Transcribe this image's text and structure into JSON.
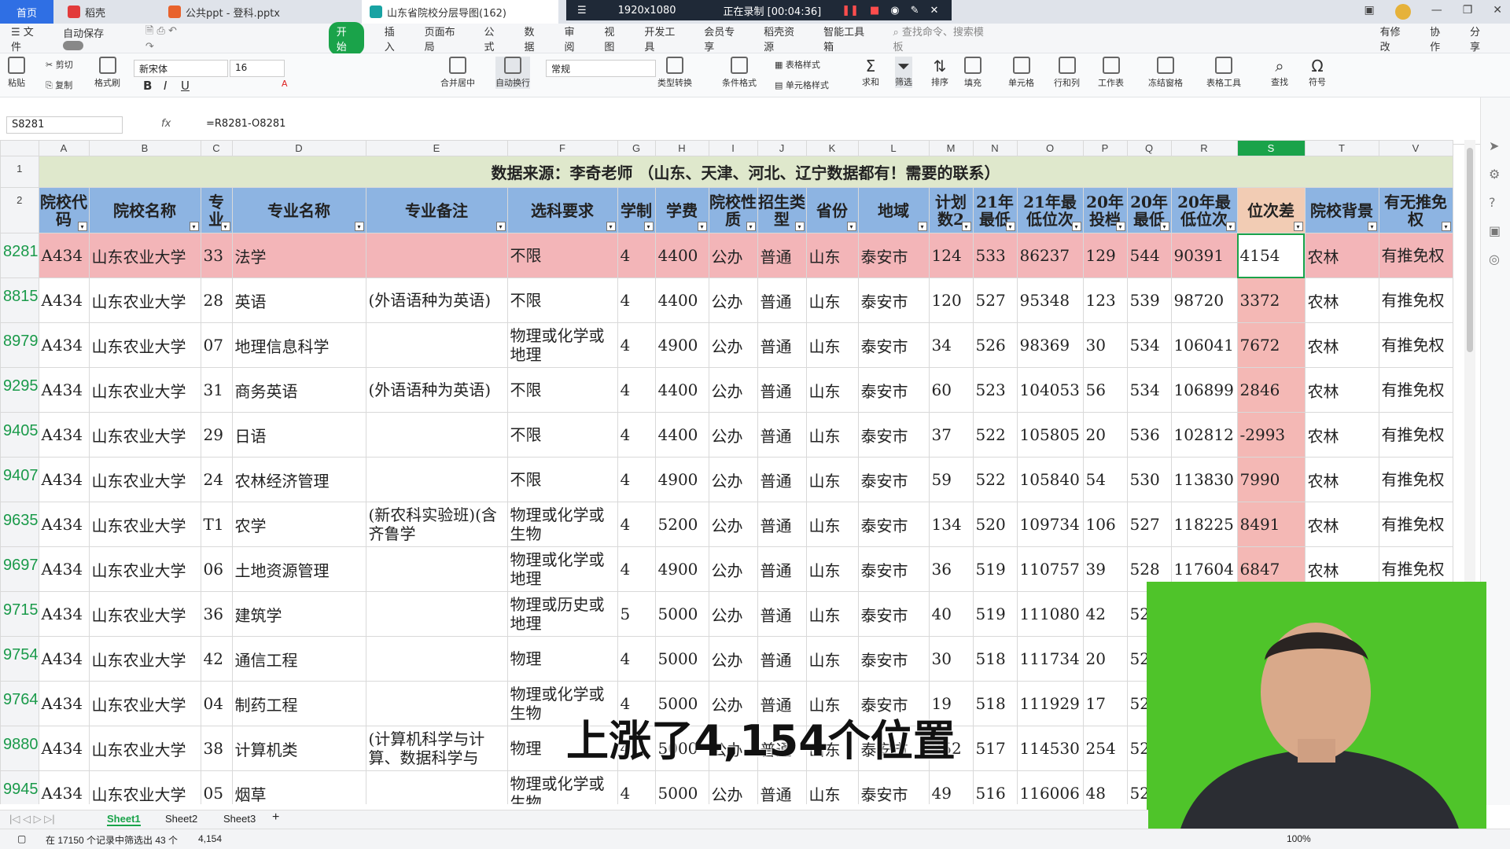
{
  "titlebar": {
    "tabs": [
      {
        "label": "首页",
        "active": false
      },
      {
        "label": "稻壳",
        "active": false
      },
      {
        "label": "公共ppt - 登科.pptx",
        "active": false
      },
      {
        "label": "山东省院校分层导图(162)",
        "active": true
      }
    ],
    "resolution": "1920x1080",
    "recording": "正在录制 [00:04:36]"
  },
  "menubar": {
    "file": "文件",
    "autosave": "自动保存",
    "items": [
      "开始",
      "插入",
      "页面布局",
      "公式",
      "数据",
      "审阅",
      "视图",
      "开发工具",
      "会员专享",
      "稻壳资源",
      "智能工具箱"
    ],
    "active": "开始",
    "search_placeholder": "查找命令、搜索模板",
    "right": [
      "有修改",
      "协作",
      "分享"
    ]
  },
  "ribbon": {
    "paste": "粘贴",
    "cut": "剪切",
    "copy": "复制",
    "format_painter": "格式刷",
    "font_name": "新宋体",
    "font_size": "16",
    "merge": "合并居中",
    "wrap": "自动换行",
    "number_format": "常规",
    "type_convert": "类型转换",
    "cond_format": "条件格式",
    "table_style": "表格样式",
    "cell_style": "单元格样式",
    "sum": "求和",
    "filter": "筛选",
    "sort": "排序",
    "fill": "填充",
    "cell": "单元格",
    "row_col": "行和列",
    "worksheet": "工作表",
    "freeze": "冻结窗格",
    "table_tools": "表格工具",
    "find": "查找",
    "symbol": "符号"
  },
  "formula_bar": {
    "name_box": "S8281",
    "fx": "fx",
    "formula": "=R8281-O8281"
  },
  "columns": [
    "A",
    "B",
    "C",
    "D",
    "E",
    "F",
    "G",
    "H",
    "I",
    "J",
    "K",
    "L",
    "M",
    "N",
    "O",
    "P",
    "Q",
    "R",
    "S",
    "T",
    "V"
  ],
  "selected_column": "S",
  "banner": "数据来源：李奇老师 （山东、天津、河北、辽宁数据都有！需要的联系）",
  "headers": [
    "院校代码",
    "院校名称",
    "专业",
    "专业名称",
    "专业备注",
    "选科要求",
    "学制",
    "学费",
    "院校性质",
    "招生类型",
    "省份",
    "地域",
    "计划数2",
    "21年最低",
    "21年最低位次",
    "20年投档",
    "20年最低",
    "20年最低位次",
    "位次差",
    "院校背景",
    "有无推免权"
  ],
  "rows": [
    {
      "row": "8281",
      "cells": [
        "A434",
        "山东农业大学",
        "33",
        "法学",
        "",
        "不限",
        "4",
        "4400",
        "公办",
        "普通",
        "山东",
        "泰安市",
        "124",
        "533",
        "86237",
        "129",
        "544",
        "90391",
        "4154",
        "农林",
        "有推免权"
      ]
    },
    {
      "row": "8815",
      "cells": [
        "A434",
        "山东农业大学",
        "28",
        "英语",
        "(外语语种为英语)",
        "不限",
        "4",
        "4400",
        "公办",
        "普通",
        "山东",
        "泰安市",
        "120",
        "527",
        "95348",
        "123",
        "539",
        "98720",
        "3372",
        "农林",
        "有推免权"
      ]
    },
    {
      "row": "8979",
      "cells": [
        "A434",
        "山东农业大学",
        "07",
        "地理信息科学",
        "",
        "物理或化学或地理",
        "4",
        "4900",
        "公办",
        "普通",
        "山东",
        "泰安市",
        "34",
        "526",
        "98369",
        "30",
        "534",
        "106041",
        "7672",
        "农林",
        "有推免权"
      ]
    },
    {
      "row": "9295",
      "cells": [
        "A434",
        "山东农业大学",
        "31",
        "商务英语",
        "(外语语种为英语)",
        "不限",
        "4",
        "4400",
        "公办",
        "普通",
        "山东",
        "泰安市",
        "60",
        "523",
        "104053",
        "56",
        "534",
        "106899",
        "2846",
        "农林",
        "有推免权"
      ]
    },
    {
      "row": "9405",
      "cells": [
        "A434",
        "山东农业大学",
        "29",
        "日语",
        "",
        "不限",
        "4",
        "4400",
        "公办",
        "普通",
        "山东",
        "泰安市",
        "37",
        "522",
        "105805",
        "20",
        "536",
        "102812",
        "-2993",
        "农林",
        "有推免权"
      ]
    },
    {
      "row": "9407",
      "cells": [
        "A434",
        "山东农业大学",
        "24",
        "农林经济管理",
        "",
        "不限",
        "4",
        "4900",
        "公办",
        "普通",
        "山东",
        "泰安市",
        "59",
        "522",
        "105840",
        "54",
        "530",
        "113830",
        "7990",
        "农林",
        "有推免权"
      ]
    },
    {
      "row": "9635",
      "cells": [
        "A434",
        "山东农业大学",
        "T1",
        "农学",
        "(新农科实验班)(含齐鲁学",
        "物理或化学或生物",
        "4",
        "5200",
        "公办",
        "普通",
        "山东",
        "泰安市",
        "134",
        "520",
        "109734",
        "106",
        "527",
        "118225",
        "8491",
        "农林",
        "有推免权"
      ]
    },
    {
      "row": "9697",
      "cells": [
        "A434",
        "山东农业大学",
        "06",
        "土地资源管理",
        "",
        "物理或化学或地理",
        "4",
        "4900",
        "公办",
        "普通",
        "山东",
        "泰安市",
        "36",
        "519",
        "110757",
        "39",
        "528",
        "117604",
        "6847",
        "农林",
        "有推免权"
      ]
    },
    {
      "row": "9715",
      "cells": [
        "A434",
        "山东农业大学",
        "36",
        "建筑学",
        "",
        "物理或历史或地理",
        "5",
        "5000",
        "公办",
        "普通",
        "山东",
        "泰安市",
        "40",
        "519",
        "111080",
        "42",
        "52",
        "",
        "",
        "",
        ""
      ]
    },
    {
      "row": "9754",
      "cells": [
        "A434",
        "山东农业大学",
        "42",
        "通信工程",
        "",
        "物理",
        "4",
        "5000",
        "公办",
        "普通",
        "山东",
        "泰安市",
        "30",
        "518",
        "111734",
        "20",
        "52",
        "",
        "",
        "",
        ""
      ]
    },
    {
      "row": "9764",
      "cells": [
        "A434",
        "山东农业大学",
        "04",
        "制药工程",
        "",
        "物理或化学或生物",
        "4",
        "5000",
        "公办",
        "普通",
        "山东",
        "泰安市",
        "19",
        "518",
        "111929",
        "17",
        "52",
        "",
        "",
        "",
        ""
      ]
    },
    {
      "row": "9880",
      "cells": [
        "A434",
        "山东农业大学",
        "38",
        "计算机类",
        "(计算机科学与计算、数据科学与",
        "物理",
        "4",
        "5000",
        "公办",
        "普通",
        "山东",
        "泰安市",
        "252",
        "517",
        "114530",
        "254",
        "52",
        "",
        "",
        "",
        ""
      ]
    },
    {
      "row": "9945",
      "cells": [
        "A434",
        "山东农业大学",
        "05",
        "烟草",
        "",
        "物理或化学或生物",
        "4",
        "5000",
        "公办",
        "普通",
        "山东",
        "泰安市",
        "49",
        "516",
        "116006",
        "48",
        "52",
        "",
        "",
        "",
        ""
      ]
    }
  ],
  "subtitle": "上涨了4,154个位置",
  "sheets": [
    "Sheet1",
    "Sheet2",
    "Sheet3"
  ],
  "active_sheet": "Sheet1",
  "status": {
    "filter_info": "在 17150 个记录中筛选出 43 个",
    "sum": "4,154",
    "zoom": "100%"
  }
}
